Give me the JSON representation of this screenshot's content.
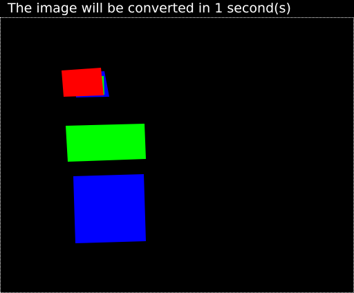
{
  "status_message": "The image will be converted in 1 second(s)",
  "colors": {
    "background": "#000000",
    "text": "#ffffff",
    "red_block": "#ff0000",
    "green_block": "#00ff00",
    "blue_block": "#0000ff"
  },
  "blocks": [
    {
      "name": "red-block",
      "color": "red"
    },
    {
      "name": "green-block",
      "color": "green"
    },
    {
      "name": "blue-block",
      "color": "blue"
    }
  ]
}
